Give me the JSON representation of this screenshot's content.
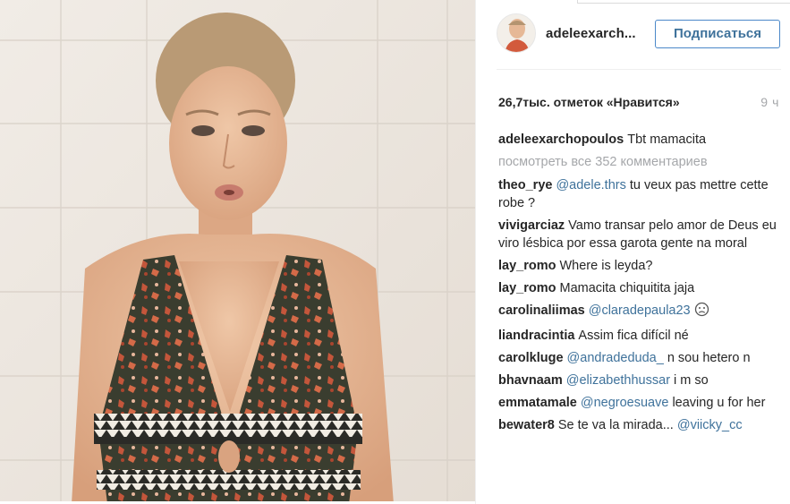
{
  "profile": {
    "username": "adeleexarch...",
    "follow_label": "Подписаться"
  },
  "post": {
    "likes": "26,7тыс. отметок «Нравится»",
    "time": "9 ч"
  },
  "caption": {
    "user": "adeleexarchopoulos",
    "text": "Tbt mamacita"
  },
  "view_all": "посмотреть все 352 комментариев",
  "comments": [
    {
      "user": "theo_rye",
      "mention": "@adele.thrs",
      "text": " tu veux pas mettre cette robe ?"
    },
    {
      "user": "vivigarciaz",
      "mention": "",
      "text": "Vamo transar pelo amor de Deus eu viro lésbica por essa garota gente na moral"
    },
    {
      "user": "lay_romo",
      "mention": "",
      "text": "Where is leyda?"
    },
    {
      "user": "lay_romo",
      "mention": "",
      "text": "Mamacita chiquitita jaja"
    },
    {
      "user": "carolinaliimas",
      "mention": "@claradepaula23",
      "text": " "
    },
    {
      "user": "liandracintia",
      "mention": "",
      "text": "Assim fica difícil né"
    },
    {
      "user": "carolkluge",
      "mention": "@andradeduda_",
      "text": " n sou hetero n"
    },
    {
      "user": "bhavnaam",
      "mention": "@elizabethhussar",
      "text": " i m so"
    },
    {
      "user": "emmatamale",
      "mention": "@negroesuave",
      "text": " leaving u for her"
    },
    {
      "user": "bewater8",
      "mention": "@viicky_cc",
      "text": "Se te va la mirada... "
    }
  ],
  "icons": {
    "emoji": "worried-face-icon"
  }
}
